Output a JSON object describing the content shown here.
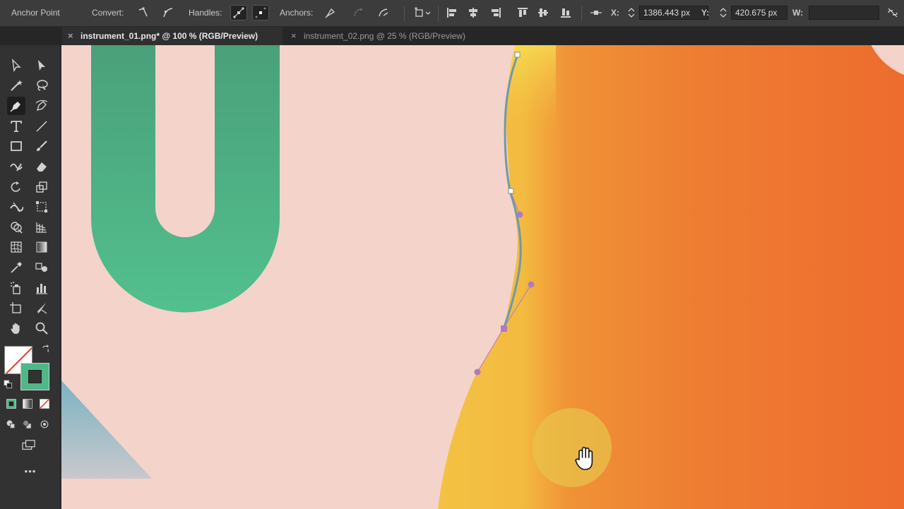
{
  "control_bar": {
    "tool_name": "Anchor Point",
    "convert_label": "Convert:",
    "handles_label": "Handles:",
    "anchors_label": "Anchors:",
    "x_label": "X:",
    "x_value": "1386.443 px",
    "y_label": "Y:",
    "y_value": "420.675 px",
    "w_label": "W:"
  },
  "tabs": [
    {
      "label": "instrument_01.png* @ 100 % (RGB/Preview)",
      "active": true
    },
    {
      "label": "instrument_02.png @ 25 % (RGB/Preview)",
      "active": false
    }
  ],
  "tabs_close_glyph": "×",
  "tools_more_glyph": "•••",
  "colors": {
    "canvas_bg": "#f4d3cb",
    "green_shape": "#4fb888",
    "orange_shape": "#ee7a32",
    "yellow_shape": "#f3c244",
    "anchor_selected": "#b07ac0",
    "stroke_swatch": "#4fb888"
  },
  "icons": [
    "selection-tool-icon",
    "direct-selection-tool-icon",
    "magic-wand-icon",
    "lasso-icon",
    "pen-icon",
    "curvature-icon",
    "type-icon",
    "line-segment-icon",
    "rectangle-icon",
    "paintbrush-icon",
    "shaper-icon",
    "eraser-icon",
    "rotate-icon",
    "scale-icon",
    "width-icon",
    "free-transform-icon",
    "shape-builder-icon",
    "perspective-grid-icon",
    "mesh-icon",
    "gradient-icon",
    "eyedropper-icon",
    "blend-icon",
    "symbol-sprayer-icon",
    "column-graph-icon",
    "artboard-icon",
    "slice-icon",
    "hand-icon",
    "zoom-icon",
    "hand-cursor-icon"
  ]
}
